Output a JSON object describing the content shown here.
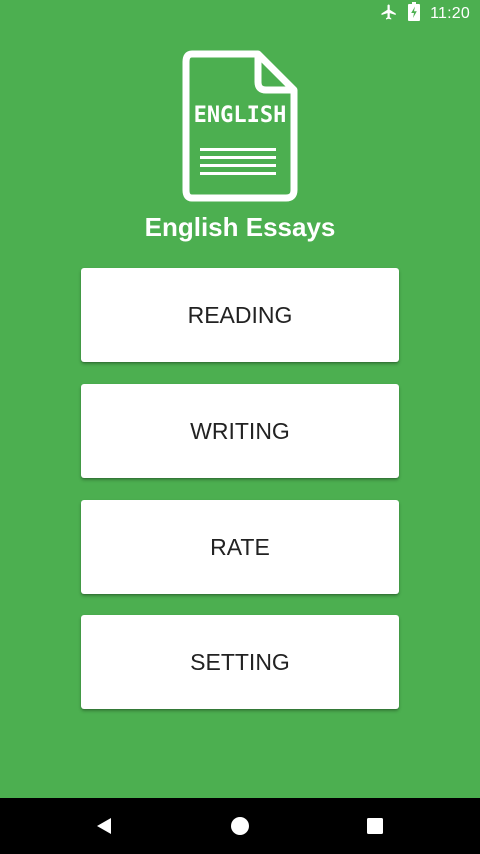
{
  "status_bar": {
    "time": "11:20",
    "icons": [
      "airplane-icon",
      "battery-charging-icon"
    ]
  },
  "logo": {
    "text": "ENGLISH",
    "icon": "document-icon"
  },
  "app": {
    "title": "English Essays"
  },
  "menu": {
    "reading_label": "READING",
    "writing_label": "WRITING",
    "rate_label": "RATE",
    "setting_label": "SETTING"
  },
  "nav_bar": {
    "icons": [
      "back-icon",
      "home-icon",
      "recents-icon"
    ]
  },
  "colors": {
    "primary_green": "#4caf50",
    "button_background": "#ffffff",
    "button_text": "#222222",
    "nav_bar": "#000000"
  }
}
